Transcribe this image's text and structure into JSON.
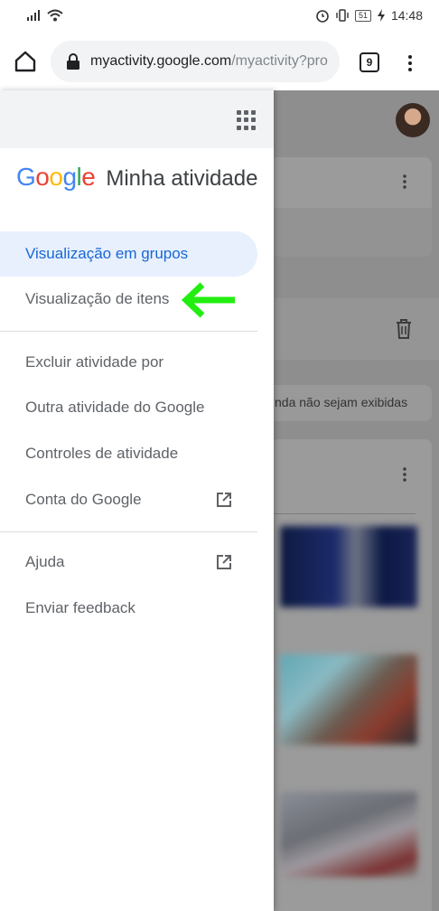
{
  "status_bar": {
    "battery": "51",
    "time": "14:48"
  },
  "browser": {
    "url_host": "myactivity.google.com",
    "url_path": "/myactivity?pro",
    "tab_count": "9"
  },
  "drawer": {
    "logo": "Google",
    "title": "Minha atividade",
    "view_items": [
      {
        "label": "Visualização em grupos",
        "active": true
      },
      {
        "label": "Visualização de itens",
        "active": false
      }
    ],
    "menu_items": [
      {
        "label": "Excluir atividade por"
      },
      {
        "label": "Outra atividade do Google"
      },
      {
        "label": "Controles de atividade"
      },
      {
        "label": "Conta do Google",
        "external": true
      }
    ],
    "footer_items": [
      {
        "label": "Ajuda",
        "external": true
      },
      {
        "label": "Enviar feedback"
      }
    ]
  },
  "background_page": {
    "notice_text": "nda não sejam exibidas"
  },
  "colors": {
    "accent": "#1967d2",
    "active_bg": "#e8f0fe",
    "arrow": "#22ee11"
  }
}
